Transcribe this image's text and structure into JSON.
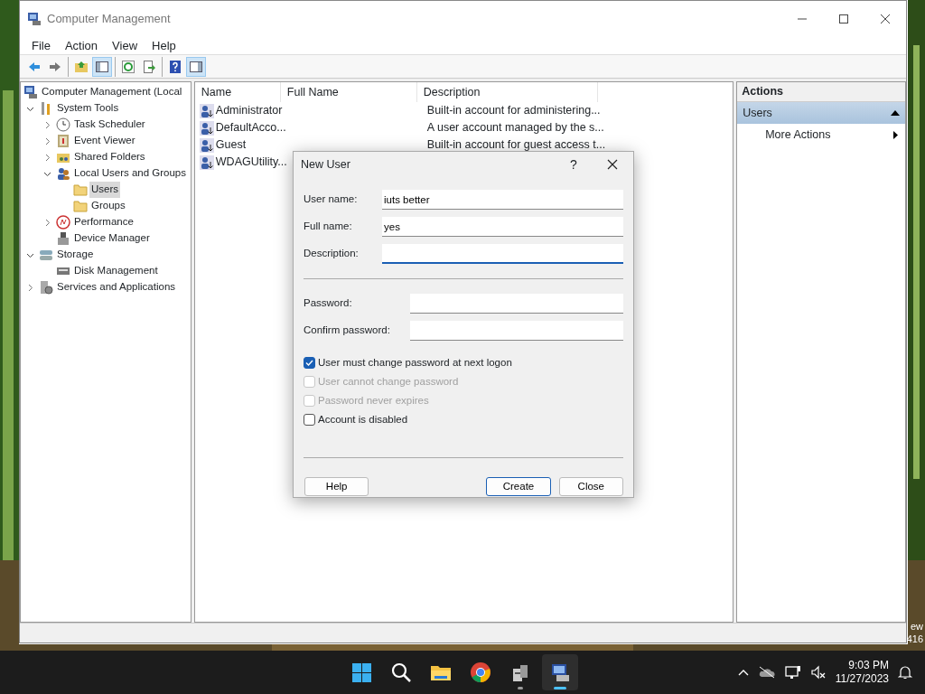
{
  "window": {
    "title": "Computer Management"
  },
  "menu": [
    "File",
    "Action",
    "View",
    "Help"
  ],
  "toolbar": [
    [
      {
        "kind": "back",
        "on": false
      },
      {
        "kind": "forward",
        "on": false
      }
    ],
    [
      {
        "kind": "up",
        "on": false
      },
      {
        "kind": "tree",
        "on": true
      }
    ],
    [
      {
        "kind": "refresh",
        "on": false
      },
      {
        "kind": "export",
        "on": false
      }
    ],
    [
      {
        "kind": "help",
        "on": false
      },
      {
        "kind": "actionpane",
        "on": true
      }
    ]
  ],
  "tree": [
    {
      "label": "Computer Management (Local",
      "kind": "computer",
      "selected": false,
      "children": [
        {
          "label": "System Tools",
          "kind": "tools",
          "expanded": true,
          "selected": false,
          "children": [
            {
              "label": "Task Scheduler",
              "kind": "clock",
              "expanded": false,
              "selected": false
            },
            {
              "label": "Event Viewer",
              "kind": "event",
              "expanded": false,
              "selected": false
            },
            {
              "label": "Shared Folders",
              "kind": "share",
              "expanded": false,
              "selected": false
            },
            {
              "label": "Local Users and Groups",
              "kind": "users",
              "expanded": true,
              "selected": false,
              "children": [
                {
                  "label": "Users",
                  "kind": "folder",
                  "selected": true
                },
                {
                  "label": "Groups",
                  "kind": "folder",
                  "selected": false
                }
              ]
            },
            {
              "label": "Performance",
              "kind": "perf",
              "expanded": false,
              "selected": false
            },
            {
              "label": "Device Manager",
              "kind": "device",
              "selected": false
            }
          ]
        },
        {
          "label": "Storage",
          "kind": "storage",
          "expanded": true,
          "selected": false,
          "children": [
            {
              "label": "Disk Management",
              "kind": "disk",
              "selected": false
            }
          ]
        },
        {
          "label": "Services and Applications",
          "kind": "services",
          "expanded": false,
          "selected": false
        }
      ]
    }
  ],
  "list": {
    "columns": [
      "Name",
      "Full Name",
      "Description"
    ],
    "rows": [
      {
        "name": "Administrator",
        "description": "Built-in account for administering..."
      },
      {
        "name": "DefaultAcco...",
        "description": "A user account managed by the s..."
      },
      {
        "name": "Guest",
        "description": "Built-in account for guest access t..."
      },
      {
        "name": "WDAGUtility..."
      }
    ]
  },
  "actions": {
    "title": "Actions",
    "section": "Users",
    "expanded": true,
    "items": [
      "More Actions"
    ]
  },
  "dialog": {
    "title": "New User",
    "help": "?",
    "fields": [
      {
        "label": "User name:",
        "value": "iuts better",
        "focused": false,
        "kind": "text"
      },
      {
        "label": "Full name:",
        "value": "yes",
        "focused": false,
        "kind": "text"
      },
      {
        "label": "Description:",
        "focused": true,
        "kind": "text"
      },
      {
        "label": "Password:",
        "focused": false,
        "kind": "password"
      },
      {
        "label": "Confirm password:",
        "focused": false,
        "kind": "password"
      }
    ],
    "checkboxes": [
      {
        "label": "User must change password at next logon",
        "checked": true,
        "disabled": false
      },
      {
        "label": "User cannot change password",
        "checked": false,
        "disabled": true
      },
      {
        "label": "Password never expires",
        "checked": false,
        "disabled": true
      },
      {
        "label": "Account is disabled",
        "checked": false,
        "disabled": false
      }
    ],
    "buttons": [
      {
        "label": "Help",
        "default": false
      },
      {
        "label": "Create",
        "default": true
      },
      {
        "label": "Close",
        "default": false
      }
    ]
  },
  "desktop_text": [
    "ew",
    "416"
  ],
  "taskbar": {
    "apps": [
      {
        "kind": "start",
        "running": false,
        "active": false
      },
      {
        "kind": "search",
        "running": false,
        "active": false
      },
      {
        "kind": "explorer",
        "running": false,
        "active": false
      },
      {
        "kind": "chrome",
        "running": false,
        "active": false
      },
      {
        "kind": "server",
        "running": true,
        "active": false
      },
      {
        "kind": "compmgmt",
        "running": true,
        "active": true
      }
    ],
    "time": "9:03 PM",
    "date": "11/27/2023"
  }
}
